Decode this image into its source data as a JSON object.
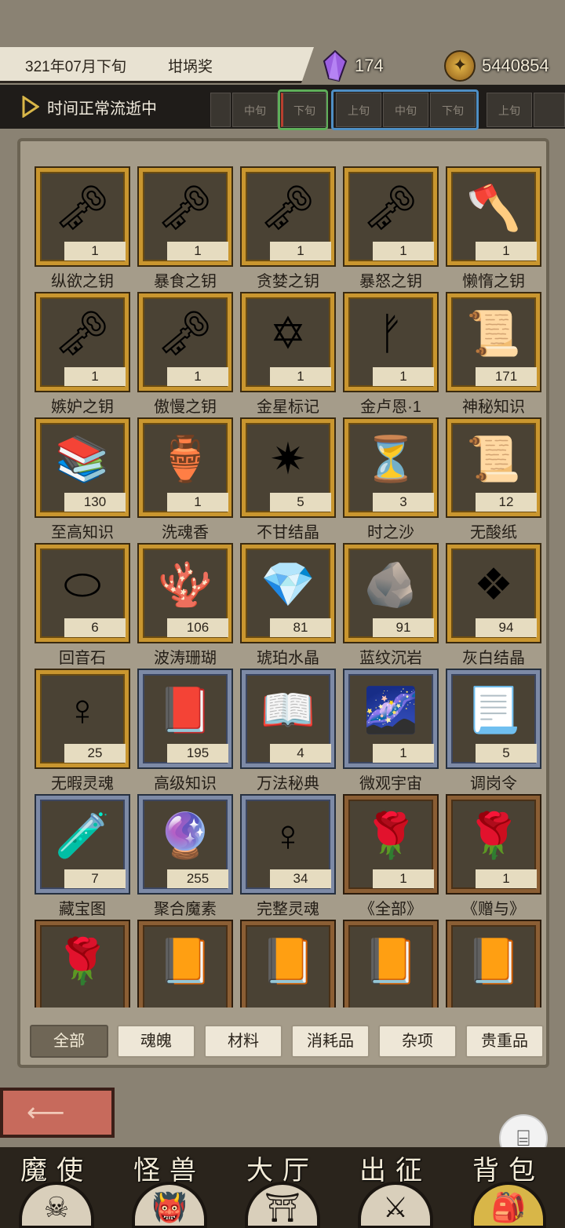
{
  "header": {
    "date": "321年07月下旬",
    "location": "坩埚奖",
    "crystals": "174",
    "gold": "5440854",
    "time_status": "时间正常流逝中",
    "slots": [
      "中旬",
      "下旬",
      "上旬",
      "中旬",
      "下旬",
      "上旬"
    ]
  },
  "items": [
    {
      "name": "纵欲之钥",
      "count": "1",
      "icon": "key-pink-icon",
      "glyph": "🗝",
      "frame": "gold"
    },
    {
      "name": "暴食之钥",
      "count": "1",
      "icon": "key-green-icon",
      "glyph": "🗝",
      "frame": "gold"
    },
    {
      "name": "贪婪之钥",
      "count": "1",
      "icon": "key-gold-icon",
      "glyph": "🗝",
      "frame": "gold"
    },
    {
      "name": "暴怒之钥",
      "count": "1",
      "icon": "key-red-icon",
      "glyph": "🗝",
      "frame": "gold"
    },
    {
      "name": "懒惰之钥",
      "count": "1",
      "icon": "key-axe-icon",
      "glyph": "🪓",
      "frame": "gold"
    },
    {
      "name": "嫉妒之钥",
      "count": "1",
      "icon": "key-blue-icon",
      "glyph": "🗝",
      "frame": "gold"
    },
    {
      "name": "傲慢之钥",
      "count": "1",
      "icon": "key-purple-icon",
      "glyph": "🗝",
      "frame": "gold"
    },
    {
      "name": "金星标记",
      "count": "1",
      "icon": "star-mark-icon",
      "glyph": "✡",
      "frame": "gold"
    },
    {
      "name": "金卢恩·1",
      "count": "1",
      "icon": "rune-icon",
      "glyph": "ᚠ",
      "frame": "gold"
    },
    {
      "name": "神秘知识",
      "count": "171",
      "icon": "tablet-icon",
      "glyph": "📜",
      "frame": "gold"
    },
    {
      "name": "至高知识",
      "count": "130",
      "icon": "tome-stack-icon",
      "glyph": "📚",
      "frame": "gold"
    },
    {
      "name": "洗魂香",
      "count": "1",
      "icon": "incense-icon",
      "glyph": "🏺",
      "frame": "gold"
    },
    {
      "name": "不甘结晶",
      "count": "5",
      "icon": "spiked-crystal-icon",
      "glyph": "✷",
      "frame": "gold"
    },
    {
      "name": "时之沙",
      "count": "3",
      "icon": "sand-icon",
      "glyph": "⏳",
      "frame": "gold"
    },
    {
      "name": "无酸纸",
      "count": "12",
      "icon": "scroll-icon",
      "glyph": "📜",
      "frame": "gold"
    },
    {
      "name": "回音石",
      "count": "6",
      "icon": "echo-stone-icon",
      "glyph": "⬭",
      "frame": "gold"
    },
    {
      "name": "波涛珊瑚",
      "count": "106",
      "icon": "coral-icon",
      "glyph": "🪸",
      "frame": "gold"
    },
    {
      "name": "琥珀水晶",
      "count": "81",
      "icon": "amber-crystal-icon",
      "glyph": "💎",
      "frame": "gold"
    },
    {
      "name": "蓝纹沉岩",
      "count": "91",
      "icon": "blue-rock-icon",
      "glyph": "🪨",
      "frame": "gold"
    },
    {
      "name": "灰白结晶",
      "count": "94",
      "icon": "grey-crystal-icon",
      "glyph": "❖",
      "frame": "gold"
    },
    {
      "name": "无暇灵魂",
      "count": "25",
      "icon": "soul-gold-icon",
      "glyph": "♀",
      "frame": "gold"
    },
    {
      "name": "高级知识",
      "count": "195",
      "icon": "book-tied-icon",
      "glyph": "📕",
      "frame": "steel"
    },
    {
      "name": "万法秘典",
      "count": "4",
      "icon": "open-tome-icon",
      "glyph": "📖",
      "frame": "steel"
    },
    {
      "name": "微观宇宙",
      "count": "1",
      "icon": "orb-galaxy-icon",
      "glyph": "🌌",
      "frame": "steel"
    },
    {
      "name": "调岗令",
      "count": "5",
      "icon": "decree-icon",
      "glyph": "📃",
      "frame": "steel"
    },
    {
      "name": "藏宝图",
      "count": "7",
      "icon": "bottle-map-icon",
      "glyph": "🧪",
      "frame": "steel"
    },
    {
      "name": "聚合魔素",
      "count": "255",
      "icon": "mana-orb-icon",
      "glyph": "🔮",
      "frame": "steel"
    },
    {
      "name": "完整灵魂",
      "count": "34",
      "icon": "soul-white-icon",
      "glyph": "♀",
      "frame": "steel"
    },
    {
      "name": "《全部》",
      "count": "1",
      "icon": "rose-book-icon",
      "glyph": "🌹",
      "frame": "wood"
    },
    {
      "name": "《赠与》",
      "count": "1",
      "icon": "rose-book-icon",
      "glyph": "🌹",
      "frame": "wood"
    },
    {
      "name": "",
      "count": "",
      "icon": "rose-book-icon",
      "glyph": "🌹",
      "frame": "wood"
    },
    {
      "name": "",
      "count": "",
      "icon": "ornate-book-icon",
      "glyph": "📙",
      "frame": "wood"
    },
    {
      "name": "",
      "count": "",
      "icon": "ornate-book-icon",
      "glyph": "📙",
      "frame": "wood"
    },
    {
      "name": "",
      "count": "",
      "icon": "ornate-book-icon",
      "glyph": "📙",
      "frame": "wood"
    },
    {
      "name": "",
      "count": "",
      "icon": "ornate-book-icon",
      "glyph": "📙",
      "frame": "wood"
    }
  ],
  "tabs": [
    "全部",
    "魂魄",
    "材料",
    "消耗品",
    "杂项",
    "贵重品"
  ],
  "active_tab": "全部",
  "nav": [
    {
      "label": "魔使",
      "icon": "demon-face-icon",
      "glyph": "☠"
    },
    {
      "label": "怪兽",
      "icon": "monster-icon",
      "glyph": "👹"
    },
    {
      "label": "大厅",
      "icon": "hall-icon",
      "glyph": "⛩"
    },
    {
      "label": "出征",
      "icon": "march-icon",
      "glyph": "⚔"
    },
    {
      "label": "背包",
      "icon": "backpack-icon",
      "glyph": "🎒"
    }
  ],
  "active_nav": "背包",
  "colors": {
    "gold_frame": "#c9962f",
    "steel_frame": "#7d8aa6",
    "wood_frame": "#8b5e34",
    "back_button": "#c76a5c"
  }
}
